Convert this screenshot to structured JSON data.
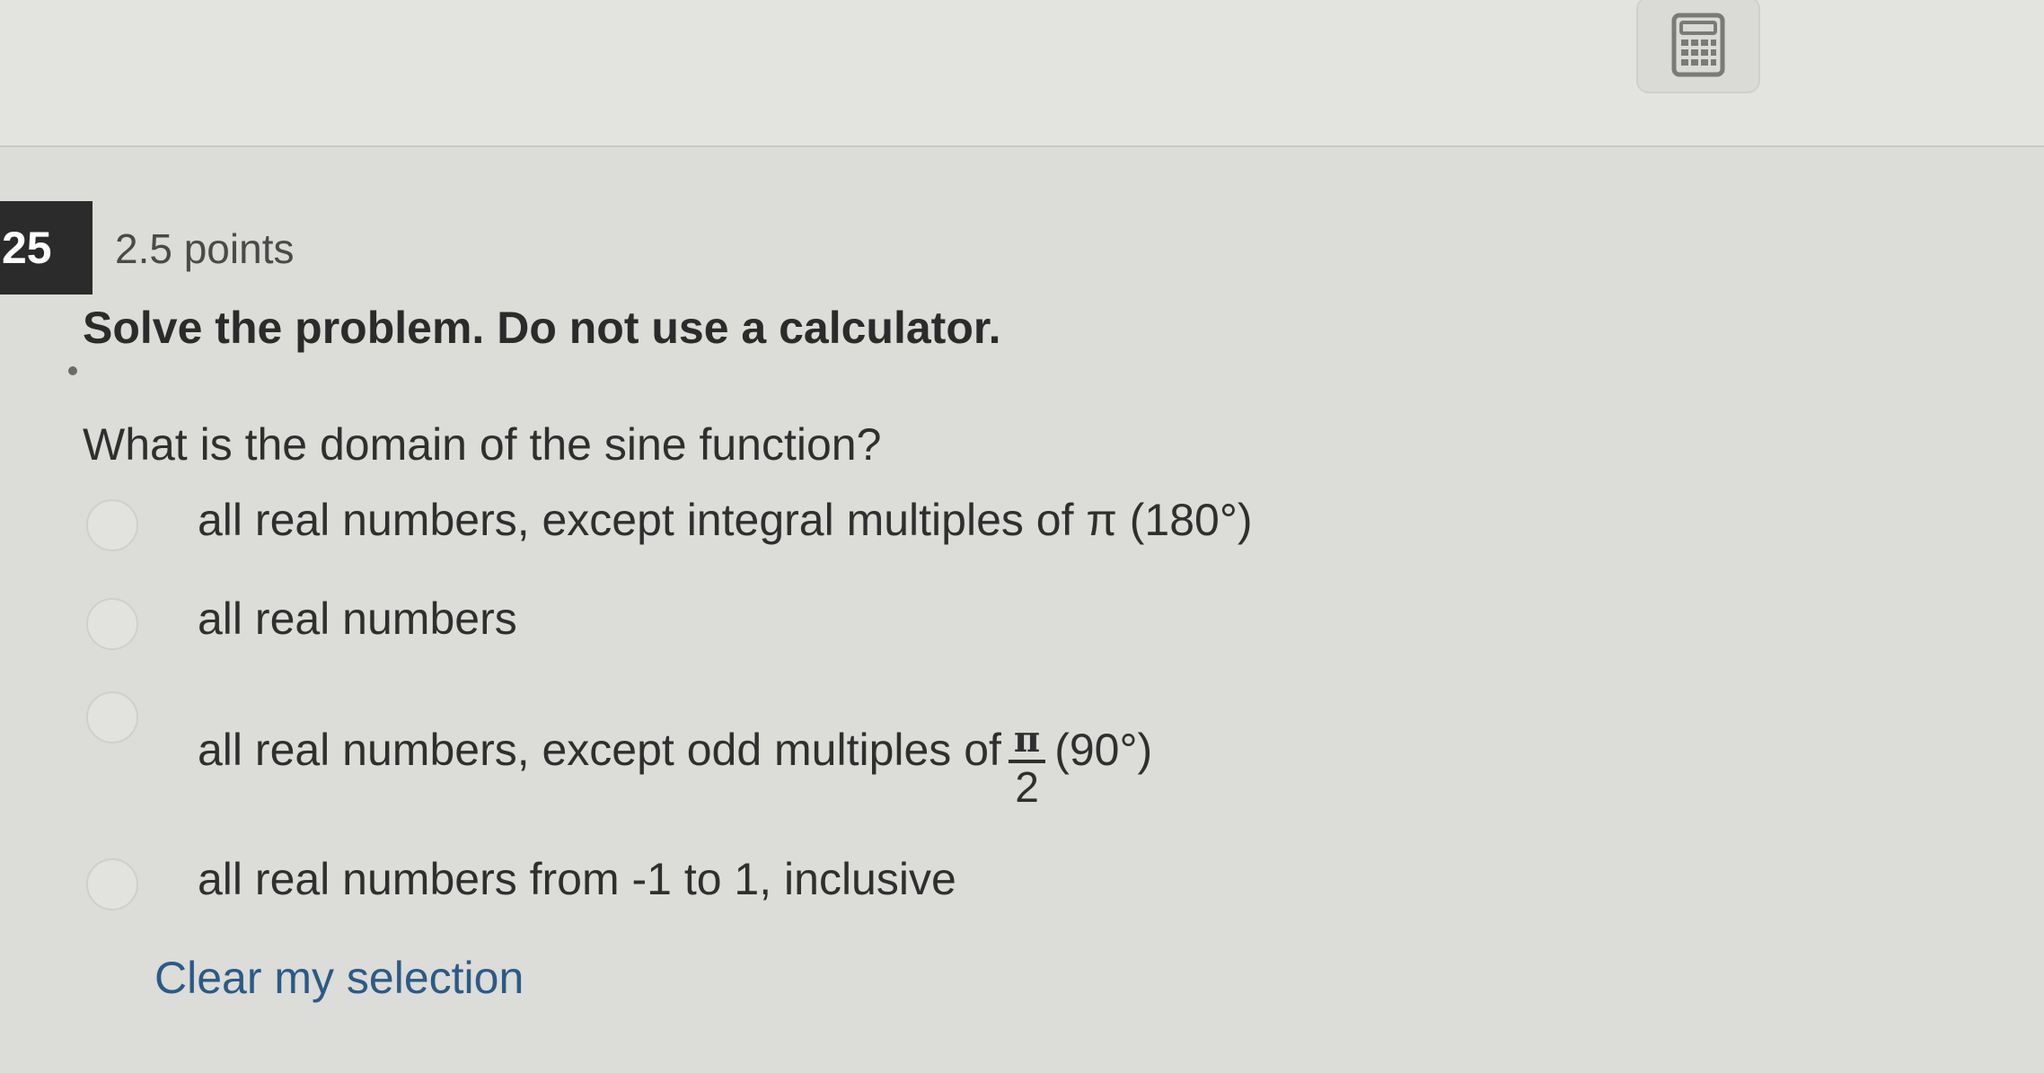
{
  "header": {
    "calculator_icon": "calculator-icon"
  },
  "question": {
    "number": "25",
    "points": "2.5 points",
    "instruction": "Solve the problem. Do not use a calculator.",
    "prompt": "What is the domain of the sine function?",
    "options": [
      {
        "label": "all real numbers, except integral multiples of π (180°)"
      },
      {
        "label": "all real numbers"
      },
      {
        "label_before": "all real numbers, except odd multiples of",
        "fraction_numerator": "π",
        "fraction_denominator": "2",
        "label_after": "(90°)"
      },
      {
        "label": "all real numbers from -1 to 1, inclusive"
      }
    ],
    "clear_label": "Clear my selection"
  }
}
